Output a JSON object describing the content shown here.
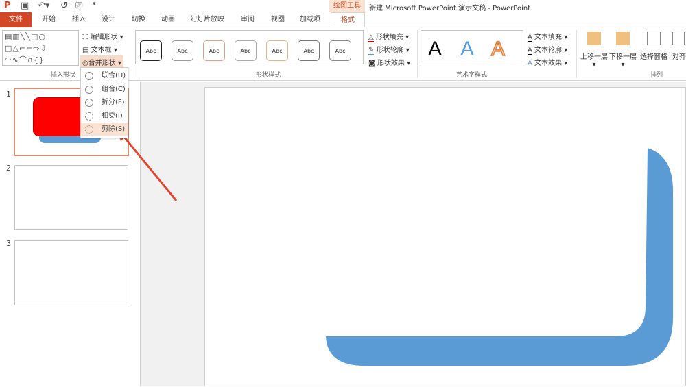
{
  "title_bar": {
    "window_title": "新建 Microsoft PowerPoint 演示文稿 - PowerPoint",
    "context_tab_group": "绘图工具",
    "quick_access": [
      "powerpoint-logo-icon",
      "save-icon",
      "undo-icon",
      "redo-icon",
      "present-icon",
      "customize-icon"
    ]
  },
  "tabs": [
    "文件",
    "开始",
    "插入",
    "设计",
    "切换",
    "动画",
    "幻灯片放映",
    "审阅",
    "视图",
    "加载项",
    "格式"
  ],
  "active_tab": "格式",
  "ribbon": {
    "insert_shapes": {
      "label": "插入形状",
      "edit_shape": "编辑形状",
      "text_box": "文本框",
      "merge_shapes": "合并形状"
    },
    "shape_styles": {
      "label": "形状样式",
      "gallery": [
        "Abc",
        "Abc",
        "Abc",
        "Abc",
        "Abc",
        "Abc",
        "Abc"
      ],
      "fill": "形状填充",
      "outline": "形状轮廓",
      "effects": "形状效果"
    },
    "wordart_styles": {
      "label": "艺术字样式",
      "gallery": [
        "A",
        "A",
        "A"
      ],
      "text_fill": "文本填充",
      "text_outline": "文本轮廓",
      "text_effects": "文本效果"
    },
    "arrange": {
      "label": "排列",
      "bring_forward": "上移一层",
      "send_backward": "下移一层",
      "selection_pane": "选择窗格",
      "align": "对齐"
    }
  },
  "merge_menu": {
    "items": [
      "联合(U)",
      "组合(C)",
      "拆分(F)",
      "相交(I)",
      "剪除(S)"
    ],
    "highlighted": "剪除(S)"
  },
  "slides": {
    "numbers": [
      "1",
      "2",
      "3"
    ],
    "selected": "1"
  },
  "colors": {
    "accent": "#d24726",
    "shape_red": "#ff0000",
    "shape_blue": "#5b9bd5",
    "arrow": "#e0452f"
  }
}
